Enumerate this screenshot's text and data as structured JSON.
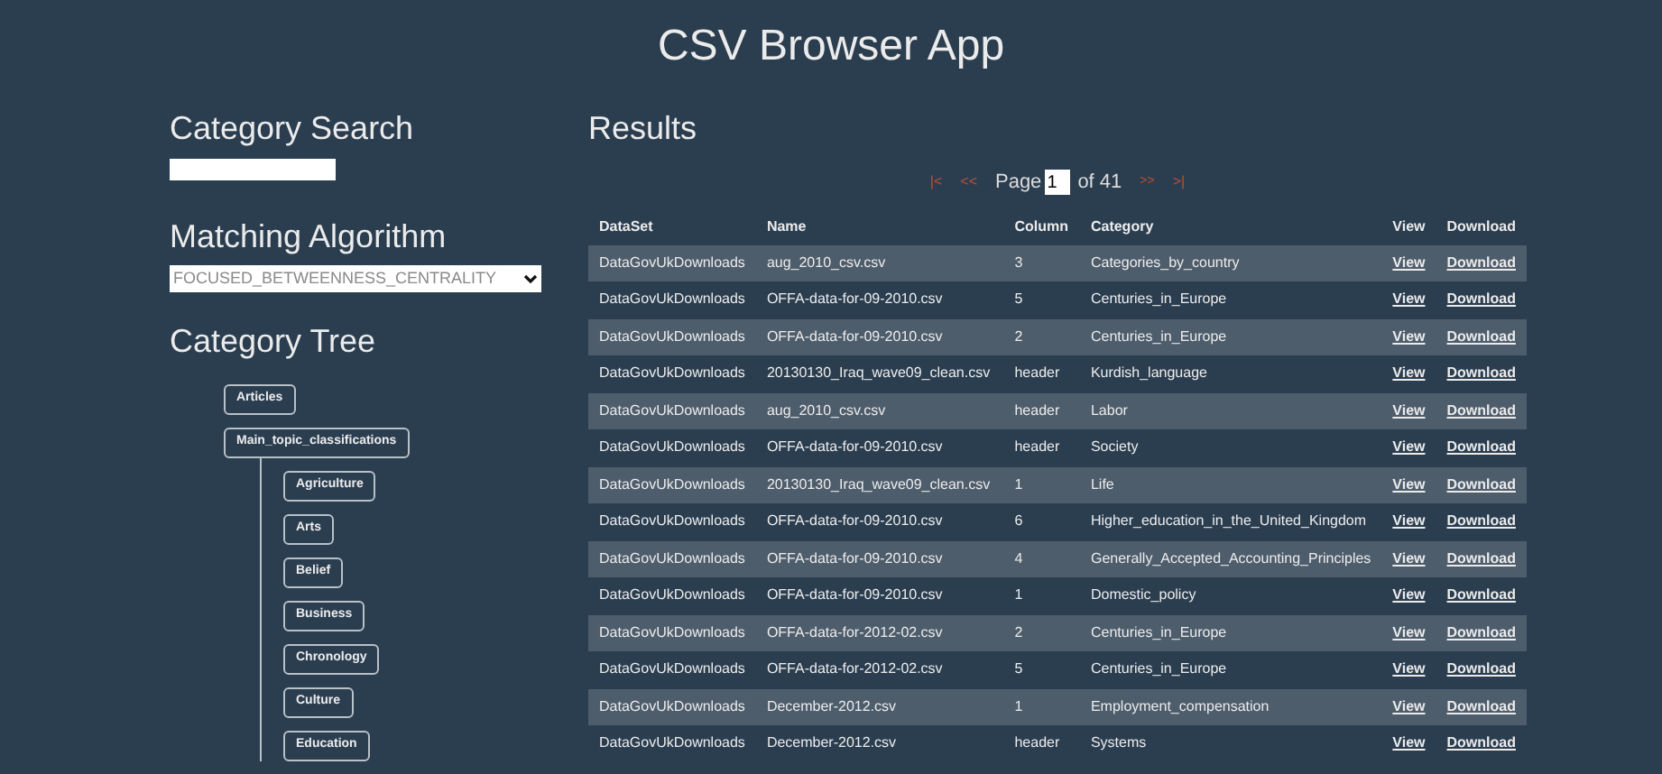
{
  "header": {
    "title": "CSV Browser App"
  },
  "sidebar": {
    "search": {
      "heading": "Category Search"
    },
    "algorithm": {
      "heading": "Matching Algorithm",
      "value": "FOCUSED_BETWEENNESS_CENTRALITY"
    },
    "tree": {
      "heading": "Category Tree",
      "nodes": [
        {
          "label": "Articles"
        },
        {
          "label": "Main_topic_classifications",
          "children": [
            {
              "label": "Agriculture"
            },
            {
              "label": "Arts"
            },
            {
              "label": "Belief"
            },
            {
              "label": "Business"
            },
            {
              "label": "Chronology"
            },
            {
              "label": "Culture"
            },
            {
              "label": "Education"
            }
          ]
        }
      ]
    }
  },
  "results": {
    "heading": "Results",
    "pager": {
      "first": "|<",
      "prev": "<<",
      "page_label": "Page",
      "page": "1",
      "of": "of 41",
      "next": ">>",
      "last": ">|"
    },
    "table": {
      "columns": [
        "DataSet",
        "Name",
        "Column",
        "Category",
        "View",
        "Download"
      ],
      "rows": [
        [
          "DataGovUkDownloads",
          "aug_2010_csv.csv",
          "3",
          "Categories_by_country",
          "View",
          "Download"
        ],
        [
          "DataGovUkDownloads",
          "OFFA-data-for-09-2010.csv",
          "5",
          "Centuries_in_Europe",
          "View",
          "Download"
        ],
        [
          "DataGovUkDownloads",
          "OFFA-data-for-09-2010.csv",
          "2",
          "Centuries_in_Europe",
          "View",
          "Download"
        ],
        [
          "DataGovUkDownloads",
          "20130130_Iraq_wave09_clean.csv",
          "header",
          "Kurdish_language",
          "View",
          "Download"
        ],
        [
          "DataGovUkDownloads",
          "aug_2010_csv.csv",
          "header",
          "Labor",
          "View",
          "Download"
        ],
        [
          "DataGovUkDownloads",
          "OFFA-data-for-09-2010.csv",
          "header",
          "Society",
          "View",
          "Download"
        ],
        [
          "DataGovUkDownloads",
          "20130130_Iraq_wave09_clean.csv",
          "1",
          "Life",
          "View",
          "Download"
        ],
        [
          "DataGovUkDownloads",
          "OFFA-data-for-09-2010.csv",
          "6",
          "Higher_education_in_the_United_Kingdom",
          "View",
          "Download"
        ],
        [
          "DataGovUkDownloads",
          "OFFA-data-for-09-2010.csv",
          "4",
          "Generally_Accepted_Accounting_Principles",
          "View",
          "Download"
        ],
        [
          "DataGovUkDownloads",
          "OFFA-data-for-09-2010.csv",
          "1",
          "Domestic_policy",
          "View",
          "Download"
        ],
        [
          "DataGovUkDownloads",
          "OFFA-data-for-2012-02.csv",
          "2",
          "Centuries_in_Europe",
          "View",
          "Download"
        ],
        [
          "DataGovUkDownloads",
          "OFFA-data-for-2012-02.csv",
          "5",
          "Centuries_in_Europe",
          "View",
          "Download"
        ],
        [
          "DataGovUkDownloads",
          "December-2012.csv",
          "1",
          "Employment_compensation",
          "View",
          "Download"
        ],
        [
          "DataGovUkDownloads",
          "December-2012.csv",
          "header",
          "Systems",
          "View",
          "Download"
        ]
      ]
    }
  }
}
